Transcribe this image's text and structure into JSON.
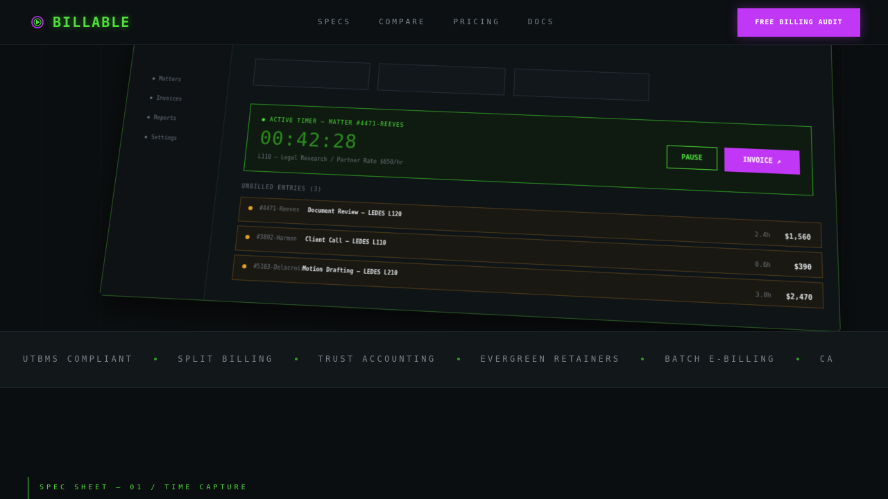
{
  "header": {
    "brand": "BILLABLE",
    "nav": [
      {
        "label": "SPECS"
      },
      {
        "label": "COMPARE"
      },
      {
        "label": "PRICING"
      },
      {
        "label": "DOCS"
      }
    ],
    "cta_label": "FREE BILLING AUDIT"
  },
  "colors": {
    "accent_green": "#4fdf3a",
    "accent_purple": "#c038f5",
    "entry_bullet": "#e3a12a",
    "background": "#0b0e10"
  },
  "dashboard": {
    "sidebar": [
      {
        "label": "Matters"
      },
      {
        "label": "Invoices"
      },
      {
        "label": "Reports"
      },
      {
        "label": "Settings"
      }
    ],
    "timer": {
      "label": "● ACTIVE TIMER — MATTER #4471-REEVES",
      "value": "00:42:28",
      "subtitle": "L110 — Legal Research / Partner Rate $650/hr",
      "pause_label": "PAUSE",
      "invoice_label": "INVOICE ↗"
    },
    "unbilled_label": "UNBILLED ENTRIES (3)",
    "entries": [
      {
        "matter": "#4471-Reeves",
        "description": "Document Review — LEDES L120",
        "hours": "2.4h",
        "amount": "$1,560"
      },
      {
        "matter": "#3892-Harmon",
        "description": "Client Call — LEDES L110",
        "hours": "0.6h",
        "amount": "$390"
      },
      {
        "matter": "#5103-Delacroix",
        "description": "Motion Drafting — LEDES L210",
        "hours": "3.8h",
        "amount": "$2,470"
      }
    ]
  },
  "features_strip": [
    "UTBMS COMPLIANT",
    "SPLIT BILLING",
    "TRUST ACCOUNTING",
    "EVERGREEN RETAINERS",
    "BATCH E-BILLING",
    "CA"
  ],
  "spec_sheet_label": "SPEC SHEET — 01 / TIME CAPTURE"
}
